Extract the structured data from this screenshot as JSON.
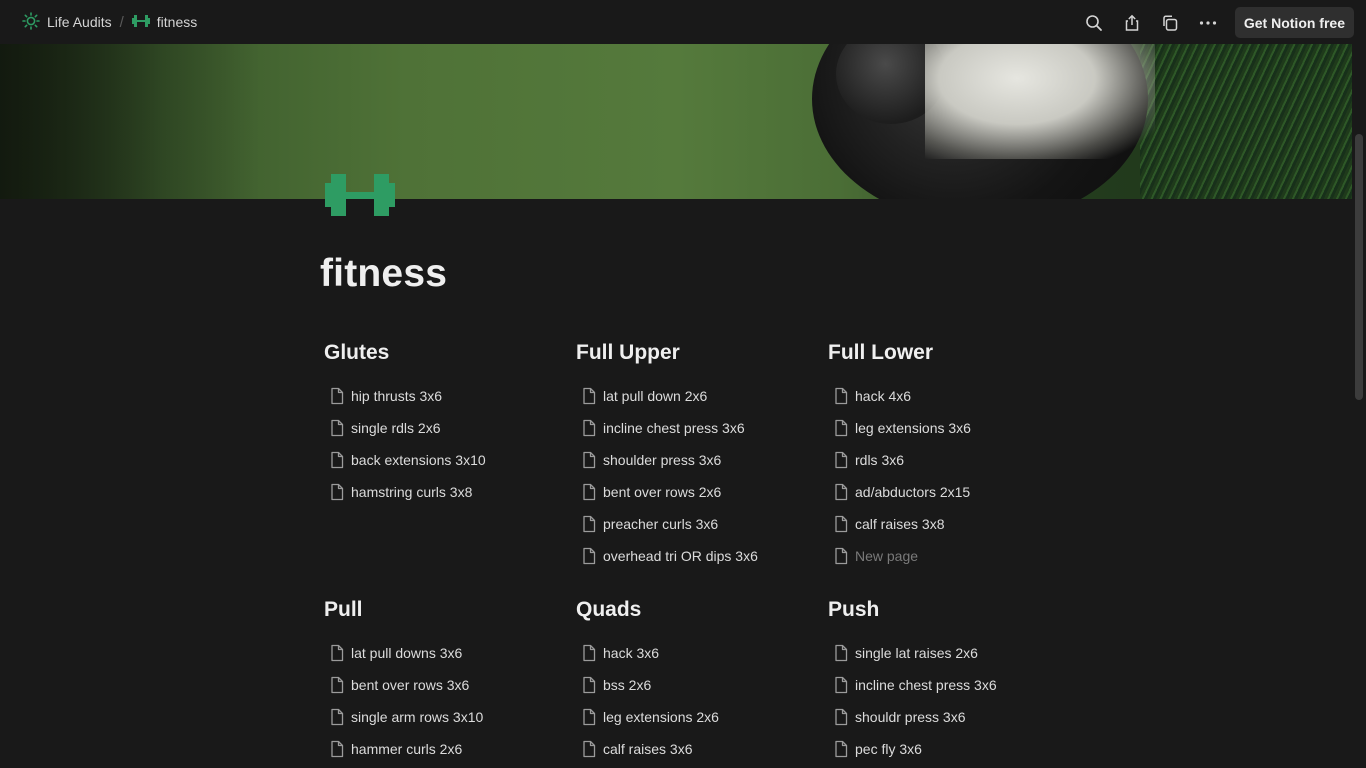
{
  "breadcrumb": {
    "workspace": "Life Audits",
    "workspace_icon": "sun-icon",
    "page": "fitness",
    "page_icon": "dumbbell-icon",
    "separator": "/"
  },
  "actions": {
    "search_icon": "search-icon",
    "share_icon": "share-icon",
    "duplicate_icon": "duplicate-icon",
    "more_icon": "more-icon",
    "cta_label": "Get Notion free"
  },
  "colors": {
    "accent_green": "#2e9c63",
    "background": "#191919"
  },
  "page": {
    "title": "fitness",
    "icon": "dumbbell-icon"
  },
  "groups": [
    {
      "title": "Glutes",
      "items": [
        "hip thrusts 3x6",
        "single rdls 2x6",
        "back extensions 3x10",
        "hamstring curls 3x8"
      ]
    },
    {
      "title": "Full Upper",
      "items": [
        "lat pull down 2x6",
        "incline chest press 3x6",
        "shoulder press 3x6",
        "bent over rows 2x6",
        "preacher curls 3x6",
        "overhead tri OR dips 3x6"
      ]
    },
    {
      "title": "Full Lower",
      "items": [
        "hack 4x6",
        "leg extensions 3x6",
        "rdls 3x6",
        "ad/abductors 2x15",
        "calf raises 3x8",
        "New page"
      ]
    },
    {
      "title": "Pull",
      "items": [
        "lat pull downs 3x6",
        "bent over rows 3x6",
        "single arm rows 3x10",
        "hammer curls 2x6"
      ]
    },
    {
      "title": "Quads",
      "items": [
        "hack 3x6",
        "bss 2x6",
        "leg extensions 2x6",
        "calf raises 3x6"
      ]
    },
    {
      "title": "Push",
      "items": [
        "single lat raises 2x6",
        "incline chest press 3x6",
        "shouldr press 3x6",
        "pec fly 3x6"
      ]
    }
  ]
}
